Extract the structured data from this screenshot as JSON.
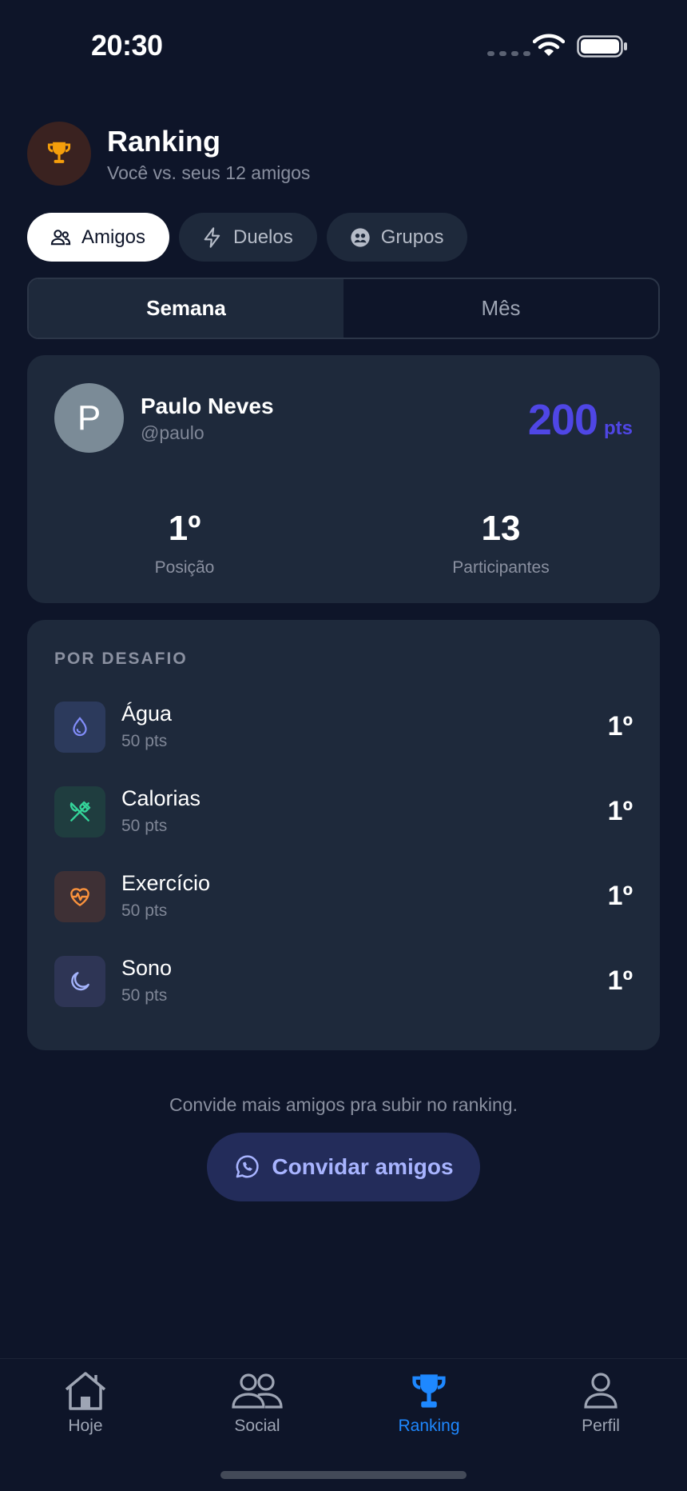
{
  "status": {
    "time": "20:30"
  },
  "header": {
    "title": "Ranking",
    "subtitle": "Você vs. seus 12 amigos"
  },
  "tabs": [
    {
      "label": "Amigos",
      "icon": "users-icon",
      "active": true
    },
    {
      "label": "Duelos",
      "icon": "lightning-icon",
      "active": false
    },
    {
      "label": "Grupos",
      "icon": "group-icon",
      "active": false
    }
  ],
  "period": {
    "options": [
      "Semana",
      "Mês"
    ],
    "selected": "Semana"
  },
  "profile": {
    "avatar_initial": "P",
    "name": "Paulo Neves",
    "handle": "@paulo",
    "points": "200",
    "points_unit": "pts",
    "position_value": "1º",
    "position_label": "Posição",
    "participants_value": "13",
    "participants_label": "Participantes"
  },
  "challenges": {
    "title": "POR DESAFIO",
    "items": [
      {
        "name": "Água",
        "points": "50 pts",
        "position": "1º",
        "icon": "water-drop-icon",
        "color": "#818cf8"
      },
      {
        "name": "Calorias",
        "points": "50 pts",
        "position": "1º",
        "icon": "fork-knife-icon",
        "color": "#34d399"
      },
      {
        "name": "Exercício",
        "points": "50 pts",
        "position": "1º",
        "icon": "heart-pulse-icon",
        "color": "#fb923c"
      },
      {
        "name": "Sono",
        "points": "50 pts",
        "position": "1º",
        "icon": "moon-icon",
        "color": "#a5b4fc"
      }
    ]
  },
  "invite": {
    "text": "Convide mais amigos pra subir no ranking.",
    "button_label": "Convidar amigos"
  },
  "tabbar": [
    {
      "label": "Hoje",
      "icon": "home-icon",
      "active": false
    },
    {
      "label": "Social",
      "icon": "people-icon",
      "active": false
    },
    {
      "label": "Ranking",
      "icon": "trophy-icon",
      "active": true
    },
    {
      "label": "Perfil",
      "icon": "person-icon",
      "active": false
    }
  ],
  "colors": {
    "background": "#0e1529",
    "card": "#1e293b",
    "accent": "#4f46e5",
    "active_tab": "#1e88ff"
  }
}
